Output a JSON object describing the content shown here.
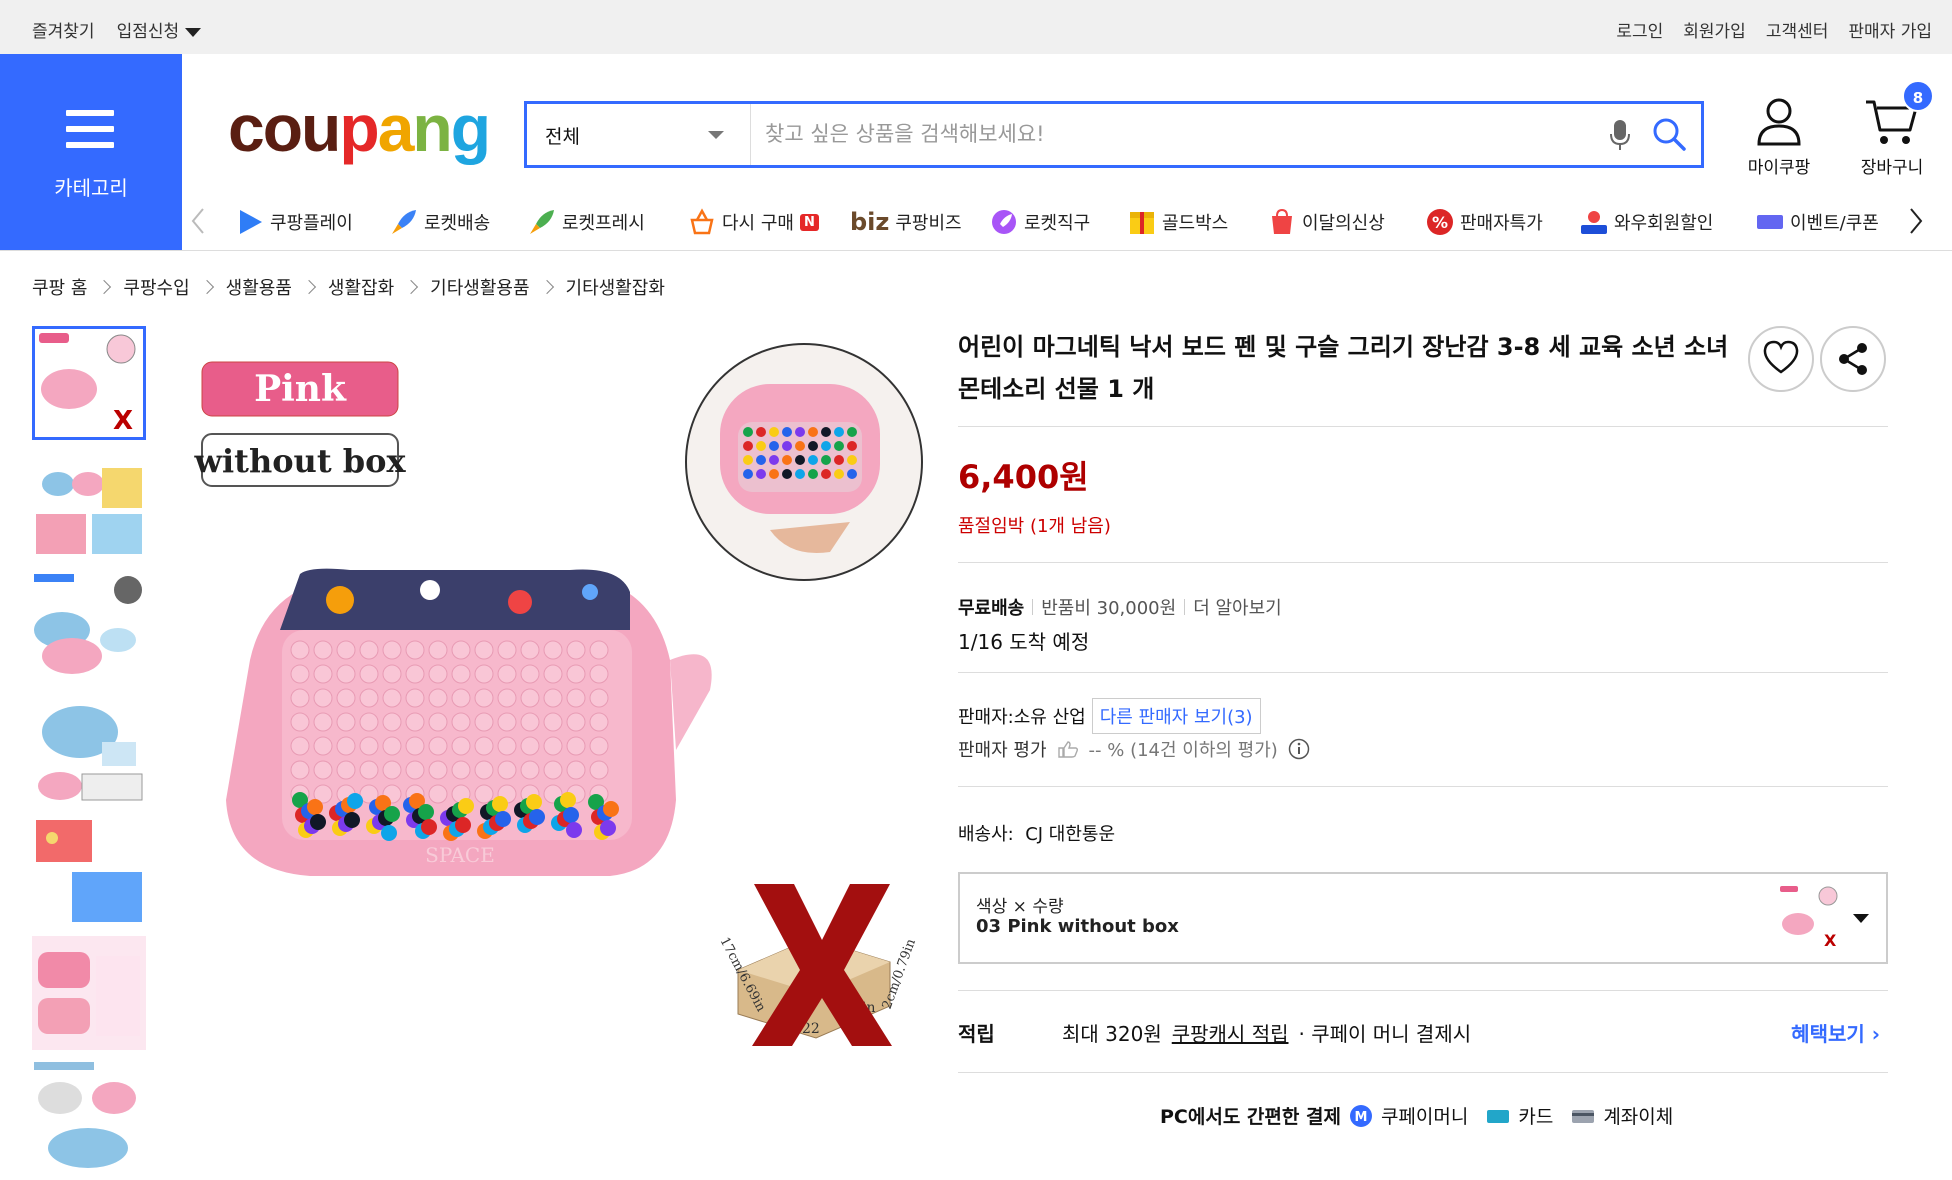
{
  "topbar": {
    "favorites": "즐겨찾기",
    "apply": "입점신청",
    "login": "로그인",
    "signup": "회원가입",
    "support": "고객센터",
    "seller_join": "판매자 가입"
  },
  "category_label": "카테고리",
  "logo": "coupang",
  "search": {
    "scope": "전체",
    "placeholder": "찾고 싶은 상품을 검색해보세요!"
  },
  "header_icons": {
    "my_coupang": "마이쿠팡",
    "cart": "장바구니",
    "cart_count": "8"
  },
  "nav_items": [
    {
      "label": "쿠팡플레이",
      "icon": "play-icon"
    },
    {
      "label": "로켓배송",
      "icon": "rocket-icon"
    },
    {
      "label": "로켓프레시",
      "icon": "rocket-fresh-icon"
    },
    {
      "label": "다시 구매",
      "icon": "rebuy-icon",
      "badge": "N"
    },
    {
      "label": "쿠팡비즈",
      "icon": "biz-icon",
      "prefix": "biz"
    },
    {
      "label": "로켓직구",
      "icon": "global-icon"
    },
    {
      "label": "골드박스",
      "icon": "goldbox-icon"
    },
    {
      "label": "이달의신상",
      "icon": "new-icon"
    },
    {
      "label": "판매자특가",
      "icon": "percent-icon"
    },
    {
      "label": "와우회원할인",
      "icon": "wow-icon"
    },
    {
      "label": "이벤트/쿠폰",
      "icon": "coupon-icon"
    }
  ],
  "breadcrumbs": [
    "쿠팡 홈",
    "쿠팡수입",
    "생활용품",
    "생활잡화",
    "기타생활용품",
    "기타생활잡화"
  ],
  "gallery": {
    "tag_pink": "Pink",
    "tag_box": "without box",
    "dim_side": "17cm/6.69in",
    "dim_height": "2cm/0.79in",
    "dim_front": "22",
    "dim_in": "in",
    "toy_brand": "SPACE"
  },
  "product": {
    "title": "어린이 마그네틱 낙서 보드 펜 및 구슬 그리기 장난감 3-8 세 교육 소년 소녀 몬테소리 선물 1 개",
    "price": "6,400원",
    "stock_status": "품절임박 (1개 남음)",
    "free_shipping": "무료배송",
    "return_fee": "반품비 30,000원",
    "learn_more": "더 알아보기",
    "arrival": "1/16 도착 예정",
    "seller_label": "판매자:",
    "seller_name": "소유 산업",
    "other_sellers": "다른 판매자 보기(3)",
    "seller_rating_label": "판매자 평가",
    "seller_rating_value": "-- % (14건 이하의 평가)",
    "courier_label": "배송사:",
    "courier_name": "CJ 대한통운",
    "option_label": "색상 × 수량",
    "option_value": "03 Pink without box",
    "reward_label": "적립",
    "reward_max": "최대 320원",
    "reward_cash": "쿠팡캐시 적립",
    "reward_condition": "· 쿠페이 머니 결제시",
    "benefit_link": "혜택보기",
    "pay_title": "PC에서도 간편한 결제",
    "pay_money": "쿠페이머니",
    "pay_card": "카드",
    "pay_account": "계좌이체"
  },
  "colors": {
    "brand_blue": "#346aff",
    "price_red": "#ae0000",
    "stock_red": "#cc0000"
  }
}
